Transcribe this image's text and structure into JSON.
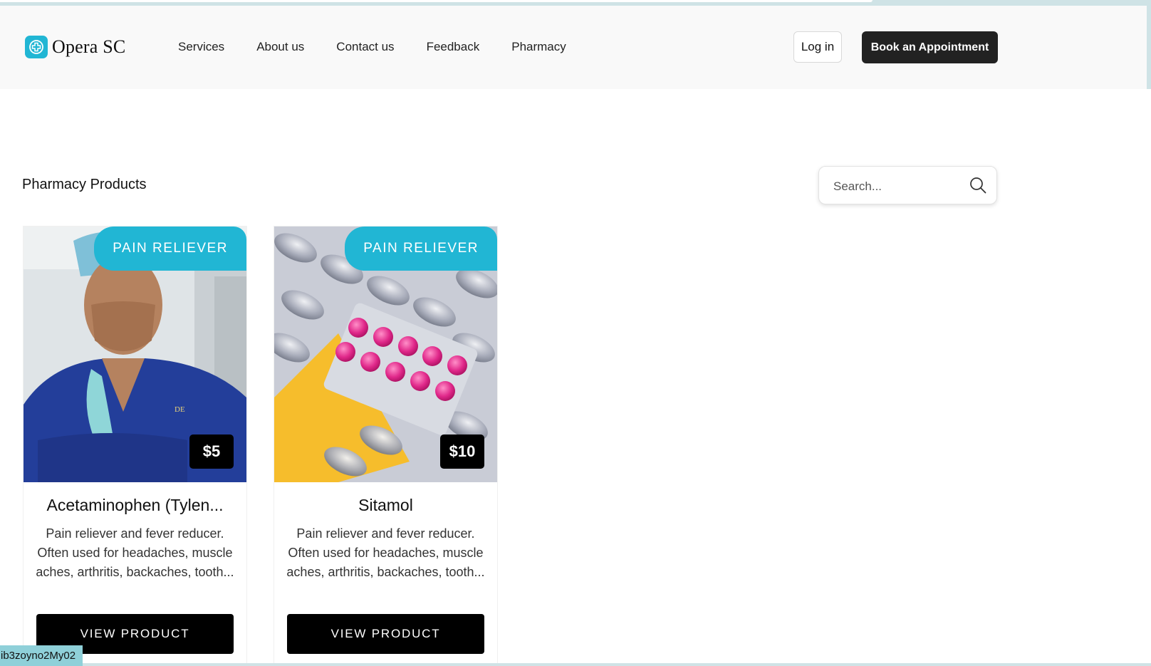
{
  "header": {
    "brand": "Opera SC",
    "nav": [
      "Services",
      "About us",
      "Contact us",
      "Feedback",
      "Pharmacy"
    ],
    "login_label": "Log in",
    "book_label": "Book an Appointment"
  },
  "main": {
    "title": "Pharmacy Products",
    "search_placeholder": "Search..."
  },
  "products": [
    {
      "category": "PAIN RELIEVER",
      "price": "$5",
      "name": "Acetaminophen (Tylen...",
      "description": "Pain reliever and fever reducer. Often used for headaches, muscle aches, arthritis, backaches, tooth...",
      "button_label": "VIEW PRODUCT",
      "image": "doctor-photo"
    },
    {
      "category": "PAIN RELIEVER",
      "price": "$10",
      "name": "Sitamol",
      "description": "Pain reliever and fever reducer. Often used for headaches, muscle aches, arthritis, backaches, tooth...",
      "button_label": "VIEW PRODUCT",
      "image": "pills-photo"
    }
  ],
  "footer_tag": "ib3zoyno2My02",
  "colors": {
    "accent": "#21b6d4",
    "dark": "#222222",
    "border_tint": "#cfe3e6"
  }
}
